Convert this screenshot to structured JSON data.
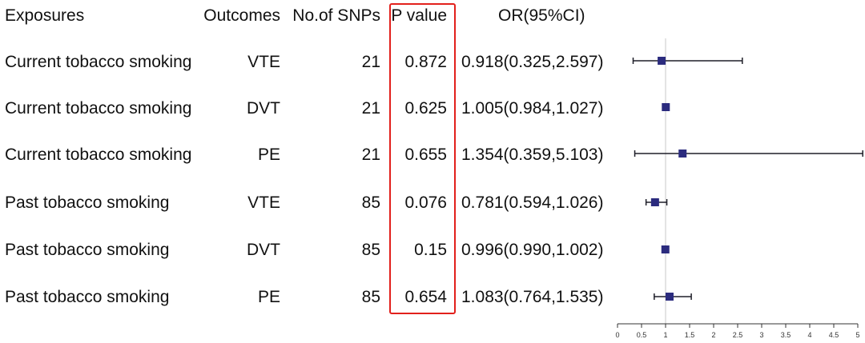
{
  "headers": {
    "exposures": "Exposures",
    "outcomes": "Outcomes",
    "snps": "No.of SNPs",
    "p_value": "P value",
    "or": "OR(95%CI)"
  },
  "rows": [
    {
      "exposure": "Current tobacco smoking",
      "outcome": "VTE",
      "snps": "21",
      "p": "0.872",
      "or_text": "0.918(0.325,2.597)"
    },
    {
      "exposure": "Current tobacco smoking",
      "outcome": "DVT",
      "snps": "21",
      "p": "0.625",
      "or_text": "1.005(0.984,1.027)"
    },
    {
      "exposure": "Current tobacco smoking",
      "outcome": "PE",
      "snps": "21",
      "p": "0.655",
      "or_text": "1.354(0.359,5.103)"
    },
    {
      "exposure": "Past tobacco smoking",
      "outcome": "VTE",
      "snps": "85",
      "p": "0.076",
      "or_text": "0.781(0.594,1.026)"
    },
    {
      "exposure": "Past tobacco smoking",
      "outcome": "DVT",
      "snps": "85",
      "p": "0.15",
      "or_text": "0.996(0.990,1.002)"
    },
    {
      "exposure": "Past tobacco smoking",
      "outcome": "PE",
      "snps": "85",
      "p": "0.654",
      "or_text": "1.083(0.764,1.535)"
    }
  ],
  "chart_data": {
    "type": "forest",
    "xlim": [
      0,
      5
    ],
    "ticks": [
      0,
      0.5,
      1,
      1.5,
      2,
      2.5,
      3,
      3.5,
      4,
      4.5,
      5
    ],
    "tick_labels": [
      "0",
      "0.5",
      "1",
      "1.5",
      "2",
      "2.5",
      "3",
      "3.5",
      "4",
      "4.5",
      "5"
    ],
    "reference_line": 1,
    "points": [
      {
        "or": 0.918,
        "lower": 0.325,
        "upper": 2.597
      },
      {
        "or": 1.005,
        "lower": 0.984,
        "upper": 1.027
      },
      {
        "or": 1.354,
        "lower": 0.359,
        "upper": 5.103
      },
      {
        "or": 0.781,
        "lower": 0.594,
        "upper": 1.026
      },
      {
        "or": 0.996,
        "lower": 0.99,
        "upper": 1.002
      },
      {
        "or": 1.083,
        "lower": 0.764,
        "upper": 1.535
      }
    ],
    "colors": {
      "marker": "#2b2b7e",
      "ci_line": "#1e1e28",
      "reference": "#c8c8c8",
      "highlight_box": "#e2201c"
    }
  }
}
